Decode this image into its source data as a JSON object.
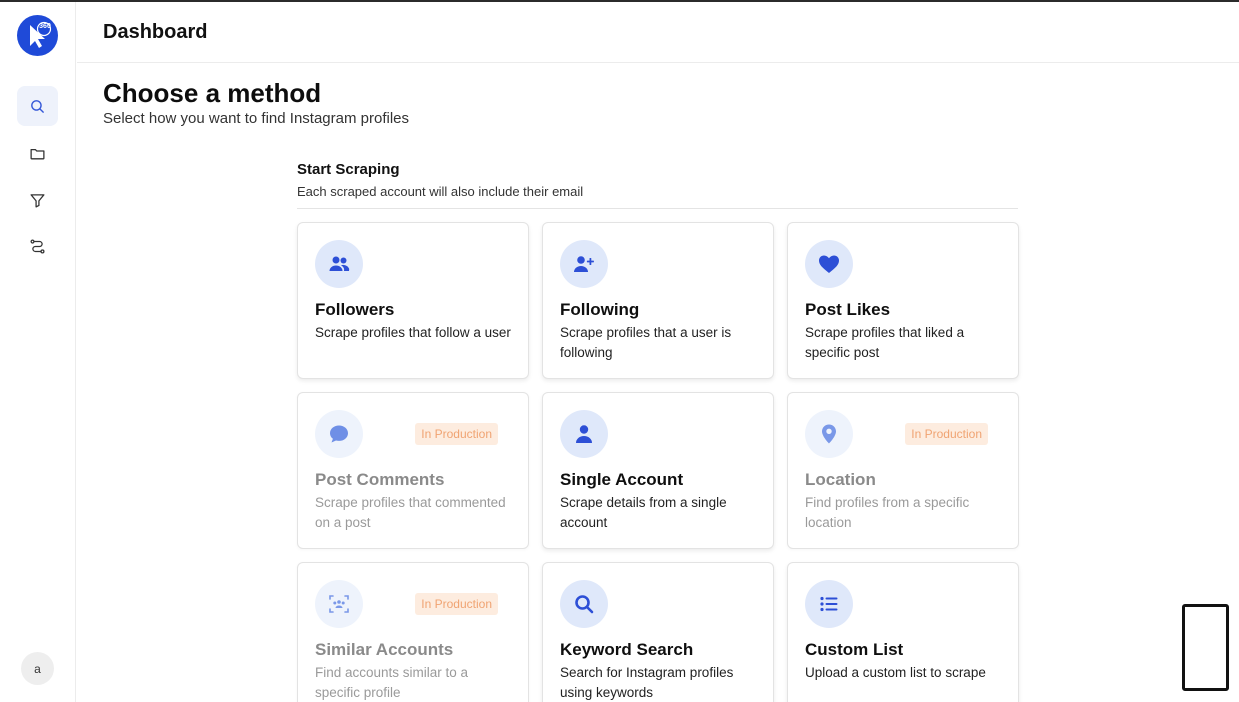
{
  "app": {
    "header_title": "Dashboard",
    "logo_text": "360"
  },
  "sidebar": {
    "items": [
      {
        "name": "search",
        "icon": "search-icon",
        "active": true
      },
      {
        "name": "folder",
        "icon": "folder-icon",
        "active": false
      },
      {
        "name": "filter",
        "icon": "filter-icon",
        "active": false
      },
      {
        "name": "workflow",
        "icon": "workflow-icon",
        "active": false
      }
    ],
    "avatar_letter": "a"
  },
  "page": {
    "title": "Choose a method",
    "subtitle": "Select how you want to find Instagram profiles"
  },
  "section": {
    "title": "Start Scraping",
    "subtitle": "Each scraped account will also include their email"
  },
  "cards": [
    {
      "title": "Followers",
      "desc": "Scrape profiles that follow a user",
      "icon": "users-icon",
      "disabled": false,
      "badge": ""
    },
    {
      "title": "Following",
      "desc": "Scrape profiles that a user is following",
      "icon": "user-plus-icon",
      "disabled": false,
      "badge": ""
    },
    {
      "title": "Post Likes",
      "desc": "Scrape profiles that liked a specific post",
      "icon": "heart-icon",
      "disabled": false,
      "badge": ""
    },
    {
      "title": "Post Comments",
      "desc": "Scrape profiles that commented on a post",
      "icon": "comment-icon",
      "disabled": true,
      "badge": "In Production"
    },
    {
      "title": "Single Account",
      "desc": "Scrape details from a single account",
      "icon": "user-icon",
      "disabled": false,
      "badge": ""
    },
    {
      "title": "Location",
      "desc": "Find profiles from a specific location",
      "icon": "location-pin-icon",
      "disabled": true,
      "badge": "In Production"
    },
    {
      "title": "Similar Accounts",
      "desc": "Find accounts similar to a specific profile",
      "icon": "group-scan-icon",
      "disabled": true,
      "badge": "In Production"
    },
    {
      "title": "Keyword Search",
      "desc": "Search for Instagram profiles using keywords",
      "icon": "search-icon",
      "disabled": false,
      "badge": ""
    },
    {
      "title": "Custom List",
      "desc": "Upload a custom list to scrape",
      "icon": "list-icon",
      "disabled": false,
      "badge": ""
    }
  ],
  "colors": {
    "brand": "#1f4ad8",
    "icon_bg": "#dfe8fa",
    "badge_bg": "#fdecdf",
    "badge_text": "#f0a372"
  }
}
